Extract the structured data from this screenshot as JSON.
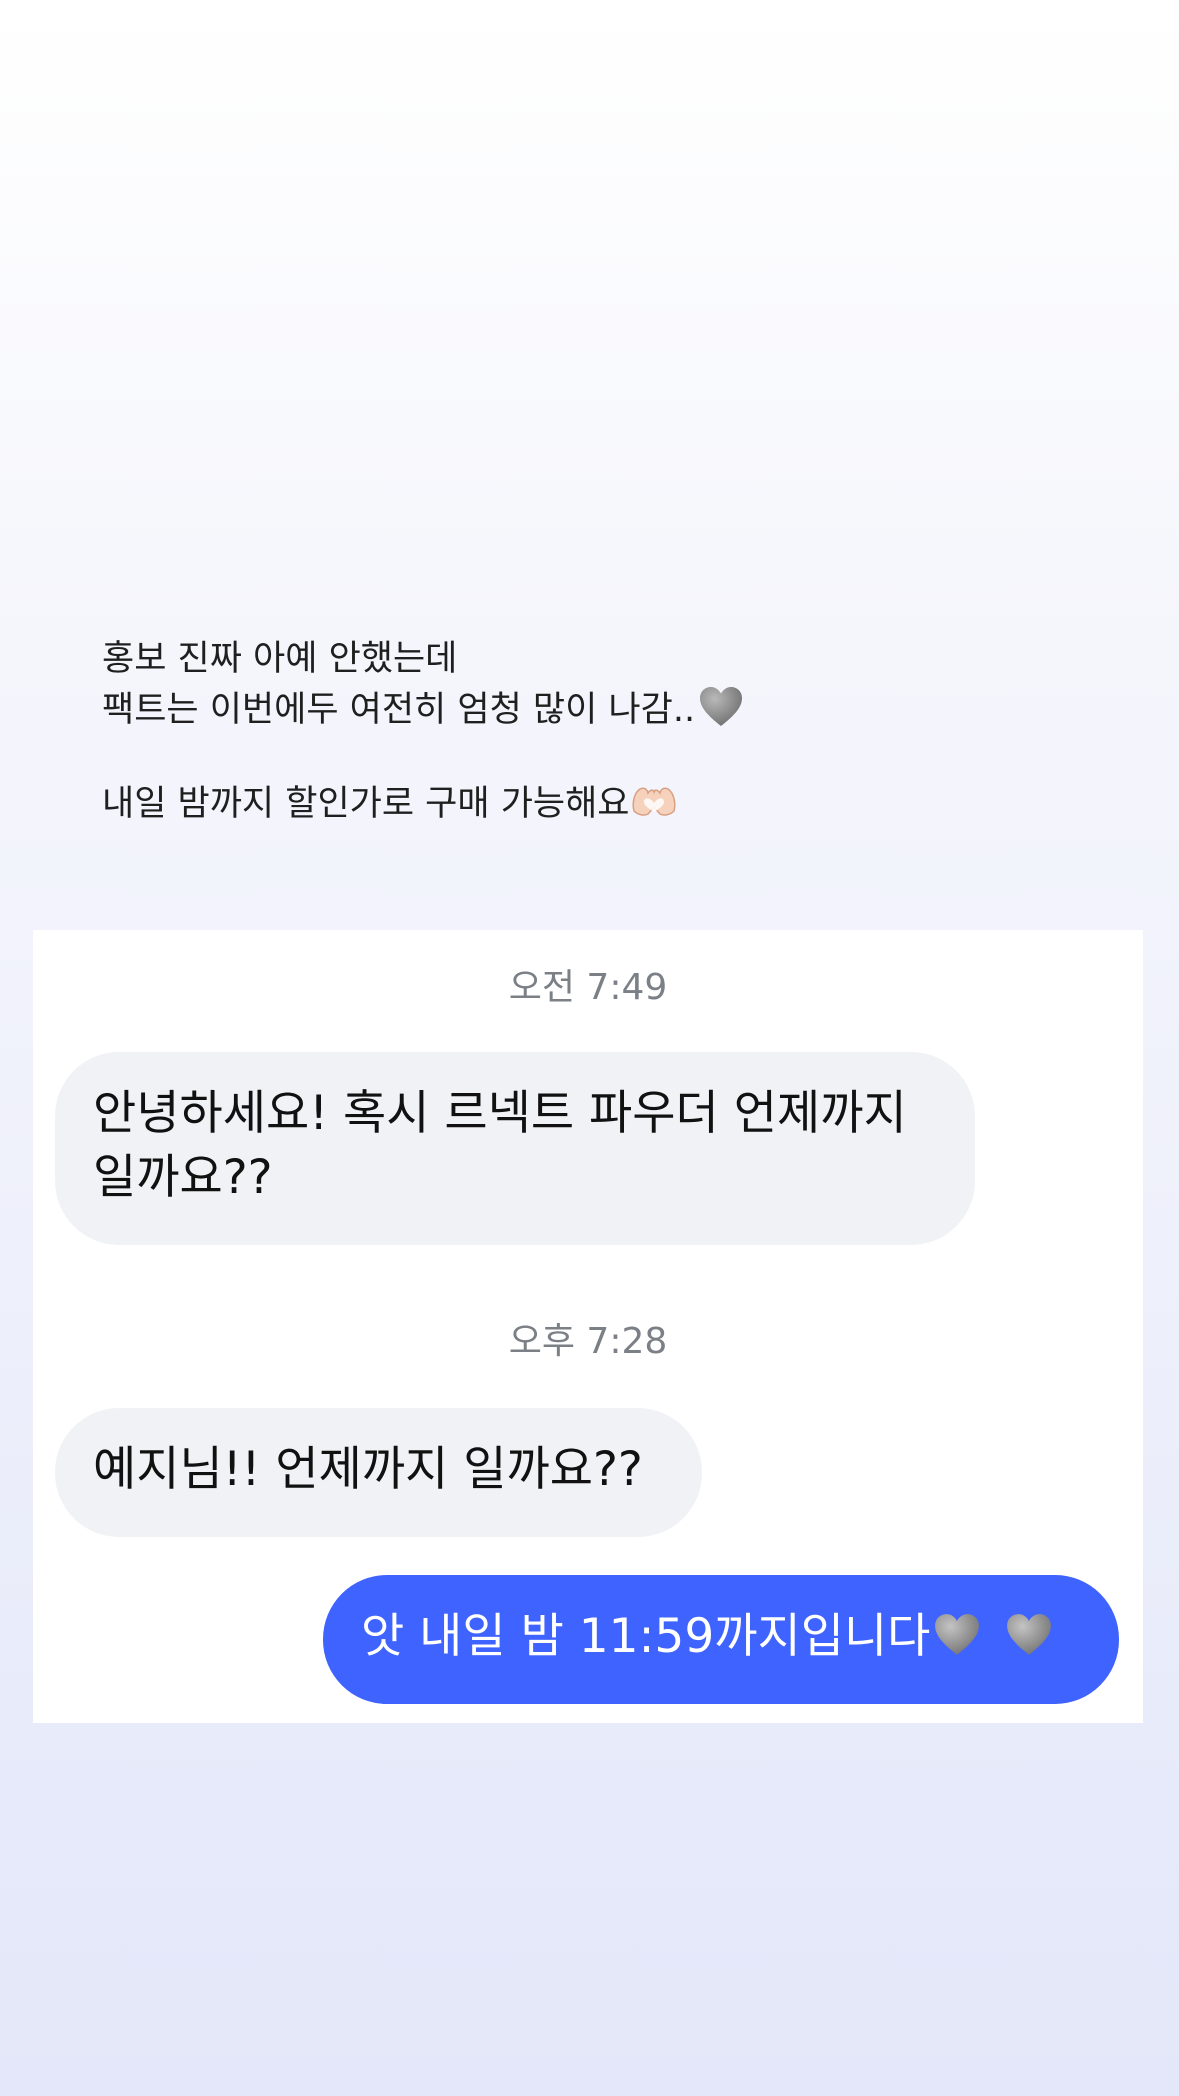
{
  "story_caption": {
    "line1": "홍보 진짜 아예 안했는데",
    "line2": "팩트는 이번에두 여전히 엄청 많이 나감..",
    "line2_icon": "grey-heart-icon",
    "line3": "내일 밤까지 할인가로 구매 가능해요",
    "line3_icon": "heart-hands-icon"
  },
  "chat": {
    "timestamp1": "오전 7:49",
    "message1": "안녕하세요! 혹시 르넥트 파우더 언제까지 일까요??",
    "message1_line1": "안녕하세요! 혹시 르넥트 파우더 언제까지",
    "message1_line2": "일까요??",
    "timestamp2": "오후 7:28",
    "message2": "예지님!!  언제까지 일까요??",
    "message3": "앗 내일 밤 11:59까지입니다",
    "message3_icons": [
      "grey-heart-icon",
      "grey-heart-icon"
    ]
  },
  "colors": {
    "outgoing_bubble": "#3f63ff",
    "incoming_bubble": "#f1f2f5",
    "timestamp_text": "#7b7f86",
    "background_top": "#ffffff",
    "background_bottom": "#e3e7f9"
  }
}
